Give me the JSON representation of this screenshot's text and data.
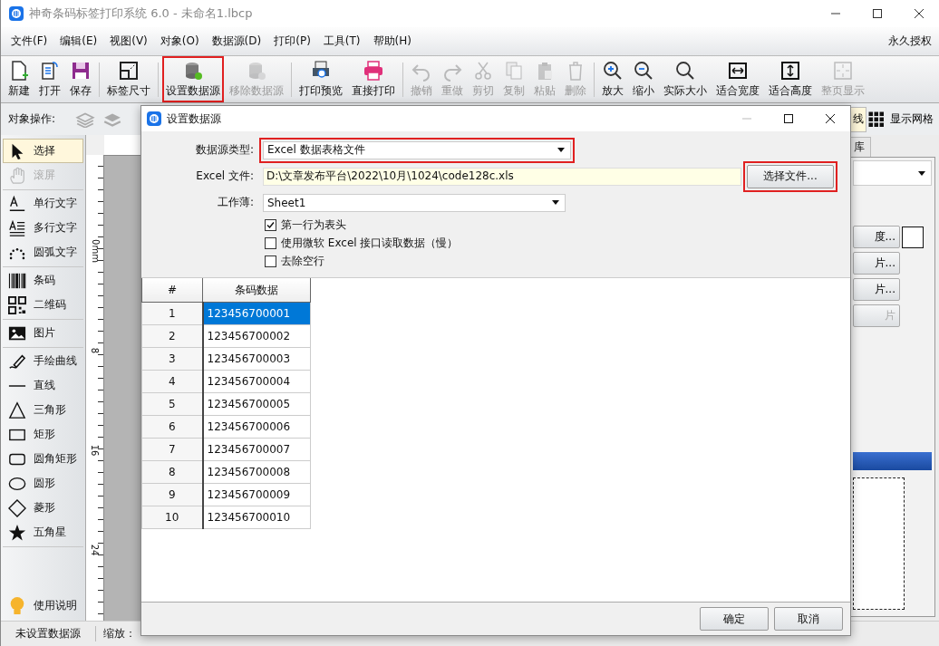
{
  "window": {
    "title": "神奇条码标签打印系统 6.0 - 未命名1.lbcp"
  },
  "menu": [
    {
      "label": "文件(F)"
    },
    {
      "label": "编辑(E)"
    },
    {
      "label": "视图(V)"
    },
    {
      "label": "对象(O)"
    },
    {
      "label": "数据源(D)"
    },
    {
      "label": "打印(P)"
    },
    {
      "label": "工具(T)"
    },
    {
      "label": "帮助(H)"
    }
  ],
  "menu_right": "永久授权",
  "toolbar": [
    [
      {
        "label": "新建",
        "disabled": false,
        "highlighted": false
      },
      {
        "label": "打开",
        "disabled": false,
        "highlighted": false
      },
      {
        "label": "保存",
        "disabled": false,
        "highlighted": false
      }
    ],
    [
      {
        "label": "标签尺寸",
        "disabled": false,
        "highlighted": false
      }
    ],
    [
      {
        "label": "设置数据源",
        "disabled": false,
        "highlighted": true
      },
      {
        "label": "移除数据源",
        "disabled": true,
        "highlighted": false
      }
    ],
    [
      {
        "label": "打印预览",
        "disabled": false,
        "highlighted": false
      },
      {
        "label": "直接打印",
        "disabled": false,
        "highlighted": false
      }
    ],
    [
      {
        "label": "撤销",
        "disabled": true,
        "highlighted": false
      },
      {
        "label": "重做",
        "disabled": true,
        "highlighted": false
      },
      {
        "label": "剪切",
        "disabled": true,
        "highlighted": false
      },
      {
        "label": "复制",
        "disabled": true,
        "highlighted": false
      },
      {
        "label": "粘贴",
        "disabled": true,
        "highlighted": false
      },
      {
        "label": "删除",
        "disabled": true,
        "highlighted": false
      }
    ],
    [
      {
        "label": "放大",
        "disabled": false,
        "highlighted": false
      },
      {
        "label": "缩小",
        "disabled": false,
        "highlighted": false
      },
      {
        "label": "实际大小",
        "disabled": false,
        "highlighted": false
      },
      {
        "label": "适合宽度",
        "disabled": false,
        "highlighted": false
      },
      {
        "label": "适合高度",
        "disabled": false,
        "highlighted": false
      },
      {
        "label": "整页显示",
        "disabled": true,
        "highlighted": false
      }
    ]
  ],
  "object_bar": {
    "label": "对象操作:",
    "partial_button": "线",
    "grid_button": "显示网格"
  },
  "tools": [
    [
      {
        "label": "选择",
        "selected": true,
        "disabled": false
      },
      {
        "label": "滚屏",
        "selected": false,
        "disabled": true
      }
    ],
    [
      {
        "label": "单行文字",
        "selected": false,
        "disabled": false
      },
      {
        "label": "多行文字",
        "selected": false,
        "disabled": false
      },
      {
        "label": "圆弧文字",
        "selected": false,
        "disabled": false
      }
    ],
    [
      {
        "label": "条码",
        "selected": false,
        "disabled": false
      },
      {
        "label": "二维码",
        "selected": false,
        "disabled": false
      }
    ],
    [
      {
        "label": "图片",
        "selected": false,
        "disabled": false
      }
    ],
    [
      {
        "label": "手绘曲线",
        "selected": false,
        "disabled": false
      },
      {
        "label": "直线",
        "selected": false,
        "disabled": false
      },
      {
        "label": "三角形",
        "selected": false,
        "disabled": false
      },
      {
        "label": "矩形",
        "selected": false,
        "disabled": false
      },
      {
        "label": "圆角矩形",
        "selected": false,
        "disabled": false
      },
      {
        "label": "圆形",
        "selected": false,
        "disabled": false
      },
      {
        "label": "菱形",
        "selected": false,
        "disabled": false
      },
      {
        "label": "五角星",
        "selected": false,
        "disabled": false
      }
    ]
  ],
  "help_button": "使用说明",
  "ruler_labels": [
    "0mm",
    "8",
    "16",
    "24"
  ],
  "right_panel": {
    "tab": "库",
    "buttons": [
      {
        "label": "度...",
        "disabled": false
      },
      {
        "label": "片...",
        "disabled": false
      },
      {
        "label": "片...",
        "disabled": false
      },
      {
        "label": "片",
        "disabled": true
      }
    ]
  },
  "status_bar": {
    "datasource": "未设置数据源",
    "zoom_label": "缩放："
  },
  "dialog": {
    "title": "设置数据源",
    "type_field": {
      "label": "数据源类型:",
      "value": "Excel 数据表格文件",
      "highlighted": true
    },
    "file_field": {
      "label": "Excel 文件:",
      "value": "D:\\文章发布平台\\2022\\10月\\1024\\code128c.xls"
    },
    "choose_button": {
      "label": "选择文件...",
      "highlighted": true
    },
    "workbook_field": {
      "label": "工作薄:",
      "value": "Sheet1"
    },
    "options": [
      {
        "label": "第一行为表头",
        "checked": true
      },
      {
        "label": "使用微软 Excel 接口读取数据（慢）",
        "checked": false
      },
      {
        "label": "去除空行",
        "checked": false
      }
    ],
    "table": {
      "columns": [
        "#",
        "条码数据"
      ],
      "rows": [
        {
          "index": "1",
          "value": "123456700001",
          "selected": true
        },
        {
          "index": "2",
          "value": "123456700002",
          "selected": false
        },
        {
          "index": "3",
          "value": "123456700003",
          "selected": false
        },
        {
          "index": "4",
          "value": "123456700004",
          "selected": false
        },
        {
          "index": "5",
          "value": "123456700005",
          "selected": false
        },
        {
          "index": "6",
          "value": "123456700006",
          "selected": false
        },
        {
          "index": "7",
          "value": "123456700007",
          "selected": false
        },
        {
          "index": "8",
          "value": "123456700008",
          "selected": false
        },
        {
          "index": "9",
          "value": "123456700009",
          "selected": false
        },
        {
          "index": "10",
          "value": "123456700010",
          "selected": false
        }
      ]
    },
    "buttons": [
      {
        "label": "确定"
      },
      {
        "label": "取消"
      }
    ]
  }
}
